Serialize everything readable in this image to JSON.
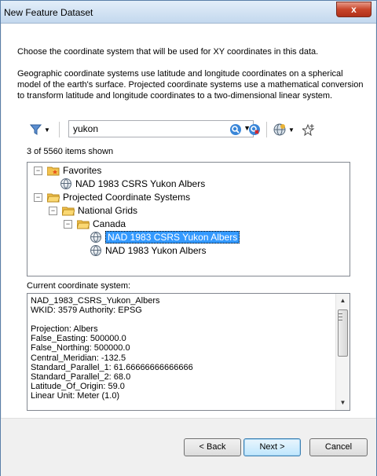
{
  "window": {
    "title": "New Feature Dataset",
    "close_label": "x"
  },
  "description": {
    "intro": "Choose the coordinate system that will be used for XY coordinates in this data.",
    "explanation": "Geographic coordinate systems use latitude and longitude coordinates on a spherical model of the earth's surface. Projected coordinate systems use a mathematical conversion to transform latitude and longitude coordinates to a two-dimensional linear system."
  },
  "toolbar": {
    "search_value": "yukon",
    "filter_icon": "filter-icon",
    "search_icon": "search-icon",
    "clear_search_icon": "clear-search-icon",
    "add_coordinate_icon": "globe-add-icon",
    "add_favorite_icon": "star-add-icon"
  },
  "tree": {
    "count_text": "3 of 5560 items shown",
    "favorites_label": "Favorites",
    "favorite_item": "NAD 1983 CSRS Yukon Albers",
    "projected_label": "Projected Coordinate Systems",
    "national_grids_label": "National Grids",
    "canada_label": "Canada",
    "selected_item": "NAD 1983 CSRS Yukon Albers",
    "other_item": "NAD 1983 Yukon Albers"
  },
  "current": {
    "label": "Current coordinate system:",
    "lines": [
      "NAD_1983_CSRS_Yukon_Albers",
      "WKID: 3579 Authority: EPSG",
      "",
      "Projection: Albers",
      "False_Easting: 500000.0",
      "False_Northing: 500000.0",
      "Central_Meridian: -132.5",
      "Standard_Parallel_1: 61.66666666666666",
      "Standard_Parallel_2: 68.0",
      "Latitude_Of_Origin: 59.0",
      "Linear Unit: Meter (1.0)"
    ]
  },
  "buttons": {
    "back": "< Back",
    "next": "Next >",
    "cancel": "Cancel"
  }
}
